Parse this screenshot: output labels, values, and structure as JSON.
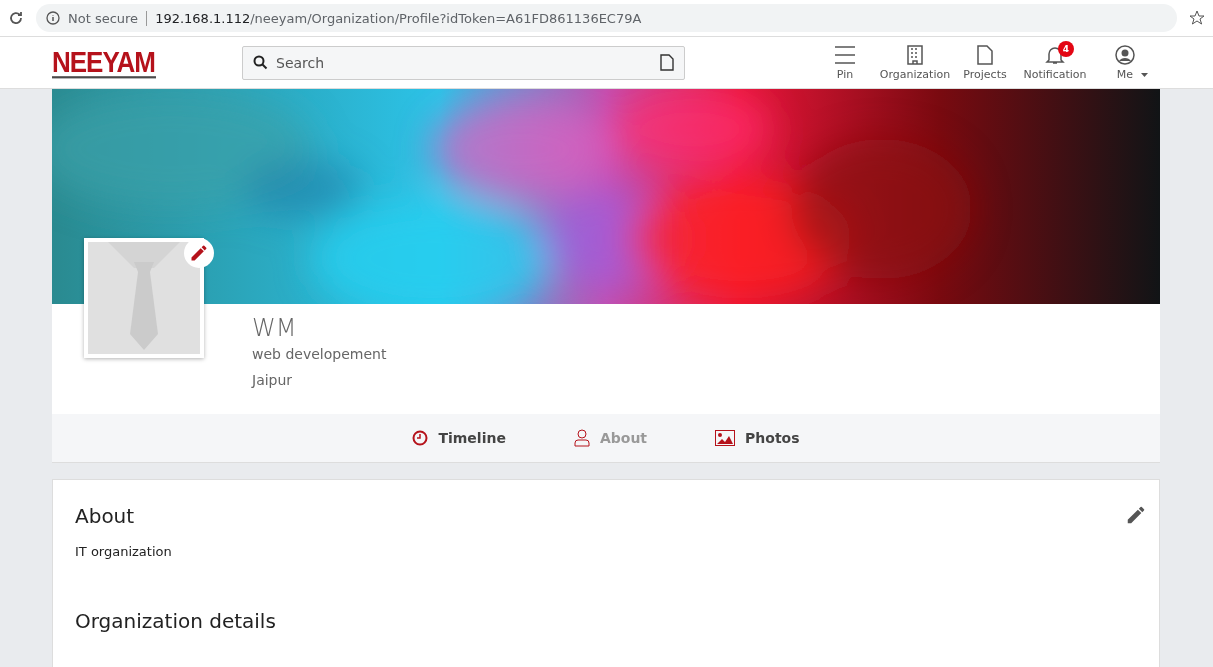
{
  "browser": {
    "security": "Not secure",
    "url_host": "192.168.1.112",
    "url_path": "/neeyam/Organization/Profile?idToken=A61FD861136EC79A"
  },
  "header": {
    "logo": "NEEYAM",
    "search": {
      "placeholder": "Search"
    },
    "nav": [
      {
        "kind": "pin",
        "label": "Pin"
      },
      {
        "kind": "organization",
        "label": "Organization"
      },
      {
        "kind": "projects",
        "label": "Projects"
      },
      {
        "kind": "notification",
        "label": "Notification",
        "badge": "4"
      },
      {
        "kind": "me",
        "label": "Me"
      }
    ]
  },
  "profile": {
    "name": "WM",
    "tagline": "web developement",
    "location": "Jaipur"
  },
  "tabs": [
    {
      "kind": "timeline",
      "label": "Timeline",
      "selected": false
    },
    {
      "kind": "about",
      "label": "About",
      "selected": true
    },
    {
      "kind": "photos",
      "label": "Photos",
      "selected": false
    }
  ],
  "about": {
    "title": "About",
    "text": "IT organization",
    "details_title": "Organization details"
  }
}
